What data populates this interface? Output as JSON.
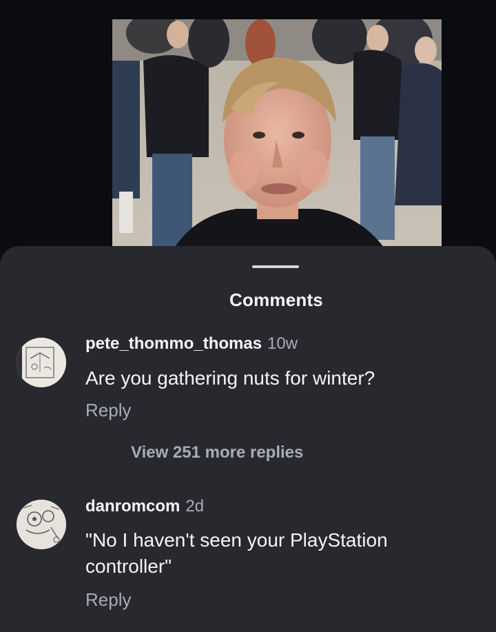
{
  "sheet": {
    "title": "Comments"
  },
  "comments": [
    {
      "username": "pete_thommo_thomas",
      "timestamp": "10w",
      "text": "Are you gathering nuts for winter?",
      "reply_label": "Reply",
      "view_replies_label": "View 251 more replies"
    },
    {
      "username": "danromcom",
      "timestamp": "2d",
      "text": "\"No I haven't seen your PlayStation controller\"",
      "reply_label": "Reply"
    }
  ],
  "colors": {
    "sheet_background": "#28292e",
    "page_background": "#0d0e12",
    "primary_text": "#f4f5f7",
    "secondary_text": "#a9acb3"
  }
}
